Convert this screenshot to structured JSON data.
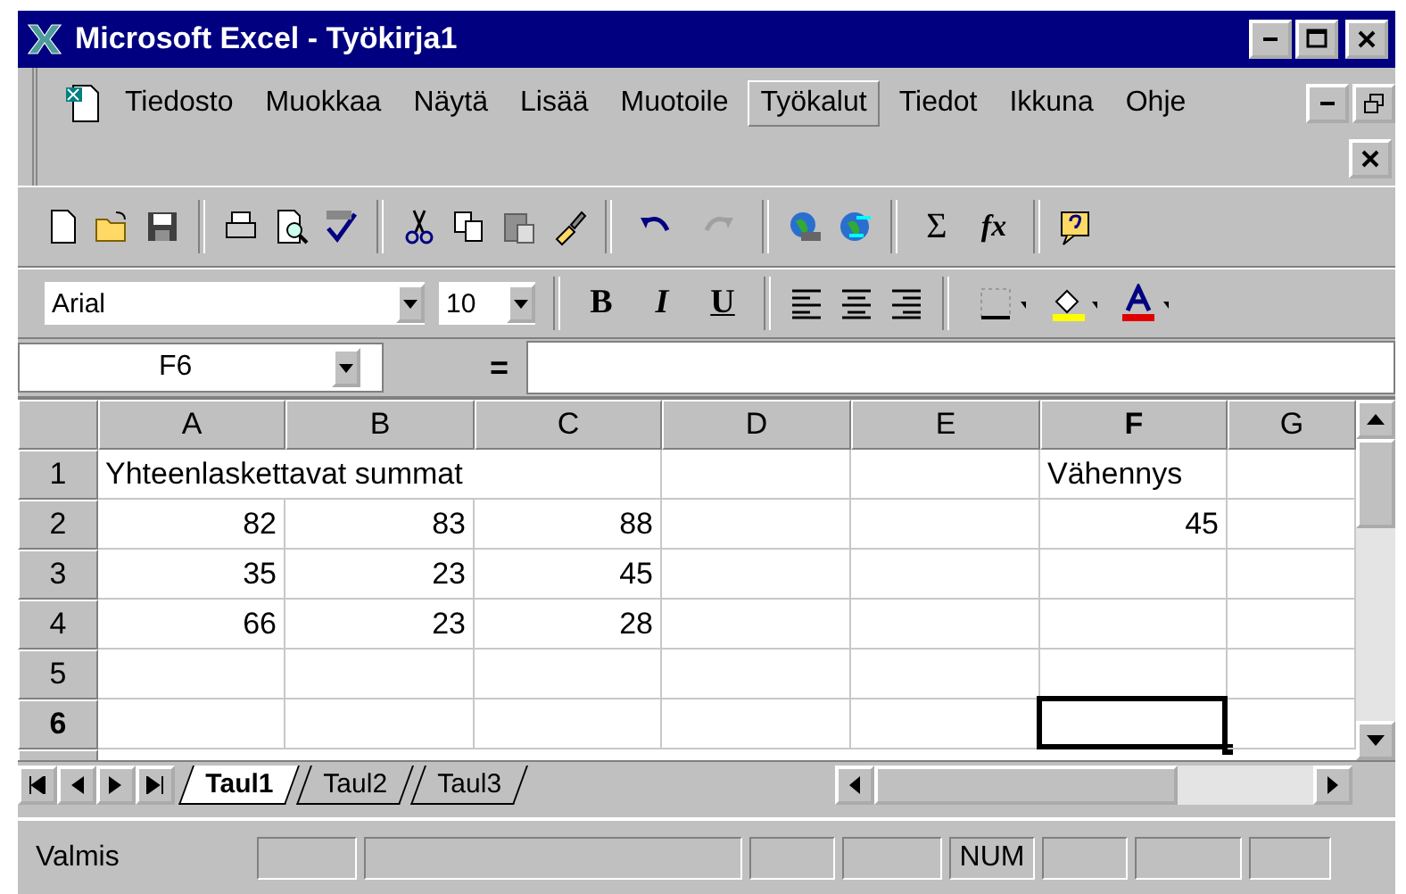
{
  "window": {
    "title": "Microsoft Excel - Työkirja1"
  },
  "menu": [
    {
      "label": "Tiedosto",
      "selected": false
    },
    {
      "label": "Muokkaa",
      "selected": false
    },
    {
      "label": "Näytä",
      "selected": false
    },
    {
      "label": "Lisää",
      "selected": false
    },
    {
      "label": "Muotoile",
      "selected": false
    },
    {
      "label": "Työkalut",
      "selected": true
    },
    {
      "label": "Tiedot",
      "selected": false
    },
    {
      "label": "Ikkuna",
      "selected": false
    },
    {
      "label": "Ohje",
      "selected": false
    }
  ],
  "standard_toolbar": {
    "sum": "Σ",
    "function": "fx"
  },
  "formatting_toolbar": {
    "font": "Arial",
    "size": "10",
    "bold": "B",
    "italic": "I",
    "underline": "U"
  },
  "formula_bar": {
    "name_box": "F6",
    "equals": "="
  },
  "columns": [
    {
      "label": "A",
      "selected": false
    },
    {
      "label": "B",
      "selected": false
    },
    {
      "label": "C",
      "selected": false
    },
    {
      "label": "D",
      "selected": false
    },
    {
      "label": "E",
      "selected": false
    },
    {
      "label": "F",
      "selected": true
    },
    {
      "label": "G",
      "selected": false
    }
  ],
  "rows": [
    {
      "label": "1",
      "selected": false,
      "cells": [
        {
          "kind": "text",
          "value": "Yhteenlaskettavat summat"
        },
        {},
        {},
        {},
        {},
        {
          "kind": "text",
          "value": "Vähennys"
        },
        {}
      ]
    },
    {
      "label": "2",
      "selected": false,
      "cells": [
        {
          "kind": "number",
          "value": "82"
        },
        {
          "kind": "number",
          "value": "83"
        },
        {
          "kind": "number",
          "value": "88"
        },
        {},
        {},
        {
          "kind": "number",
          "value": "45"
        },
        {}
      ]
    },
    {
      "label": "3",
      "selected": false,
      "cells": [
        {
          "kind": "number",
          "value": "35"
        },
        {
          "kind": "number",
          "value": "23"
        },
        {
          "kind": "number",
          "value": "45"
        },
        {},
        {},
        {},
        {}
      ]
    },
    {
      "label": "4",
      "selected": false,
      "cells": [
        {
          "kind": "number",
          "value": "66"
        },
        {
          "kind": "number",
          "value": "23"
        },
        {
          "kind": "number",
          "value": "28"
        },
        {},
        {},
        {},
        {}
      ]
    },
    {
      "label": "5",
      "selected": false,
      "cells": [
        {},
        {},
        {},
        {},
        {},
        {},
        {}
      ]
    },
    {
      "label": "6",
      "selected": true,
      "cells": [
        {},
        {},
        {},
        {},
        {},
        {
          "active": true
        },
        {}
      ]
    }
  ],
  "sheet_tabs": [
    {
      "label": "Taul1",
      "selected": true
    },
    {
      "label": "Taul2",
      "selected": false
    },
    {
      "label": "Taul3",
      "selected": false
    }
  ],
  "status_bar": {
    "message": "Valmis",
    "indicators": [
      {
        "kind": "blank"
      },
      {
        "kind": "blank"
      },
      {
        "kind": "blank"
      },
      {
        "kind": "blank"
      },
      {
        "kind": "text",
        "text": "NUM"
      },
      {
        "kind": "blank"
      },
      {
        "kind": "blank"
      },
      {
        "kind": "blank"
      }
    ]
  }
}
